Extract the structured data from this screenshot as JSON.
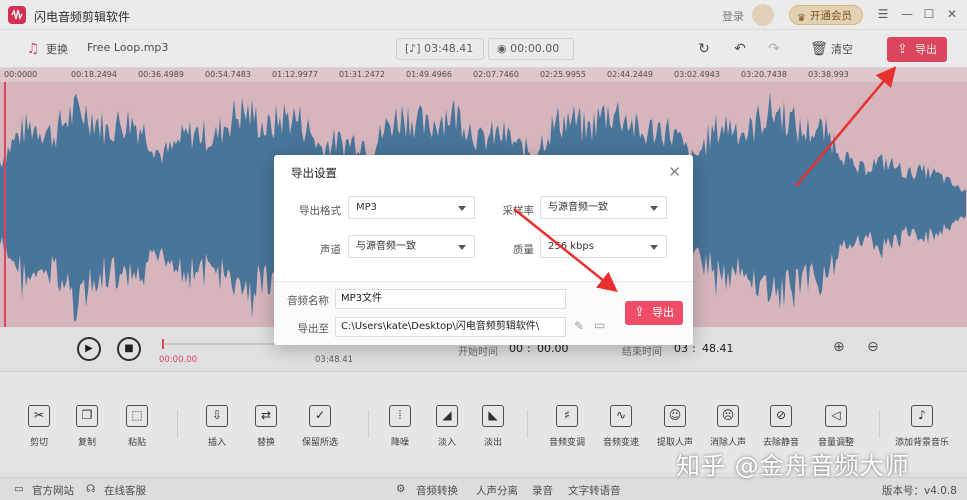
{
  "app": {
    "title": "闪电音频剪辑软件",
    "login": "登录",
    "vip": "开通会员"
  },
  "toolbar": {
    "replace": "更换",
    "filename": "Free Loop.mp3",
    "duration": "03:48.41",
    "selection": "00:00.00",
    "clear": "清空",
    "export": "导出"
  },
  "timeline": {
    "ticks": [
      "00:0000",
      "00:18.2494",
      "00:36.4989",
      "00:54.7483",
      "01:12.9977",
      "01:31.2472",
      "01:49.4966",
      "02:07.7460",
      "02:25.9955",
      "02:44.2449",
      "03:02.4943",
      "03:20.7438",
      "03:38.993"
    ]
  },
  "playback": {
    "current": "00:00.00",
    "total": "03:48.41",
    "start_label": "开始时间",
    "start_min": "00",
    "start_sec": "00.00",
    "end_label": "结束时间",
    "end_min": "03",
    "end_sec": "48.41"
  },
  "tools": [
    {
      "label": "剪切",
      "icon": "scissors-icon",
      "glyph": "✂"
    },
    {
      "label": "复制",
      "icon": "copy-icon",
      "glyph": "❐"
    },
    {
      "label": "粘贴",
      "icon": "paste-icon",
      "glyph": "⬚"
    },
    {
      "label": "插入",
      "icon": "insert-icon",
      "glyph": "⇩"
    },
    {
      "label": "替换",
      "icon": "replace-icon",
      "glyph": "⇄"
    },
    {
      "label": "保留所选",
      "icon": "keep-selection-icon",
      "glyph": "✓"
    },
    {
      "label": "降噪",
      "icon": "denoise-icon",
      "glyph": "⦙"
    },
    {
      "label": "淡入",
      "icon": "fade-in-icon",
      "glyph": "◢"
    },
    {
      "label": "淡出",
      "icon": "fade-out-icon",
      "glyph": "◣"
    },
    {
      "label": "音频变调",
      "icon": "pitch-icon",
      "glyph": "♯"
    },
    {
      "label": "音频变速",
      "icon": "speed-icon",
      "glyph": "∿"
    },
    {
      "label": "提取人声",
      "icon": "extract-voice-icon",
      "glyph": "☺"
    },
    {
      "label": "消除人声",
      "icon": "remove-voice-icon",
      "glyph": "☹"
    },
    {
      "label": "去除静音",
      "icon": "remove-silence-icon",
      "glyph": "⊘"
    },
    {
      "label": "音量调整",
      "icon": "volume-icon",
      "glyph": "◁"
    },
    {
      "label": "添加背景音乐",
      "icon": "bg-music-icon",
      "glyph": "♪"
    }
  ],
  "statusbar": {
    "website": "官方网站",
    "support": "在线客服",
    "convert": "音频转换",
    "separate": "人声分离",
    "record": "录音",
    "tts": "文字转语音",
    "version": "版本号：v4.0.8"
  },
  "watermark": "知乎 @金舟音频大师",
  "dialog": {
    "title": "导出设置",
    "format_label": "导出格式",
    "format_value": "MP3",
    "samplerate_label": "采样率",
    "samplerate_value": "与源音频一致",
    "channel_label": "声道",
    "channel_value": "与源音频一致",
    "quality_label": "质量",
    "quality_value": "256 kbps",
    "name_label": "音频名称",
    "name_value": "MP3文件",
    "path_label": "导出至",
    "path_value": "C:\\Users\\kate\\Desktop\\闪电音频剪辑软件\\",
    "export": "导出"
  },
  "colors": {
    "accent": "#ee4d67",
    "wave": "#4f7fa6",
    "wave_bg": "#e9c6cd"
  }
}
